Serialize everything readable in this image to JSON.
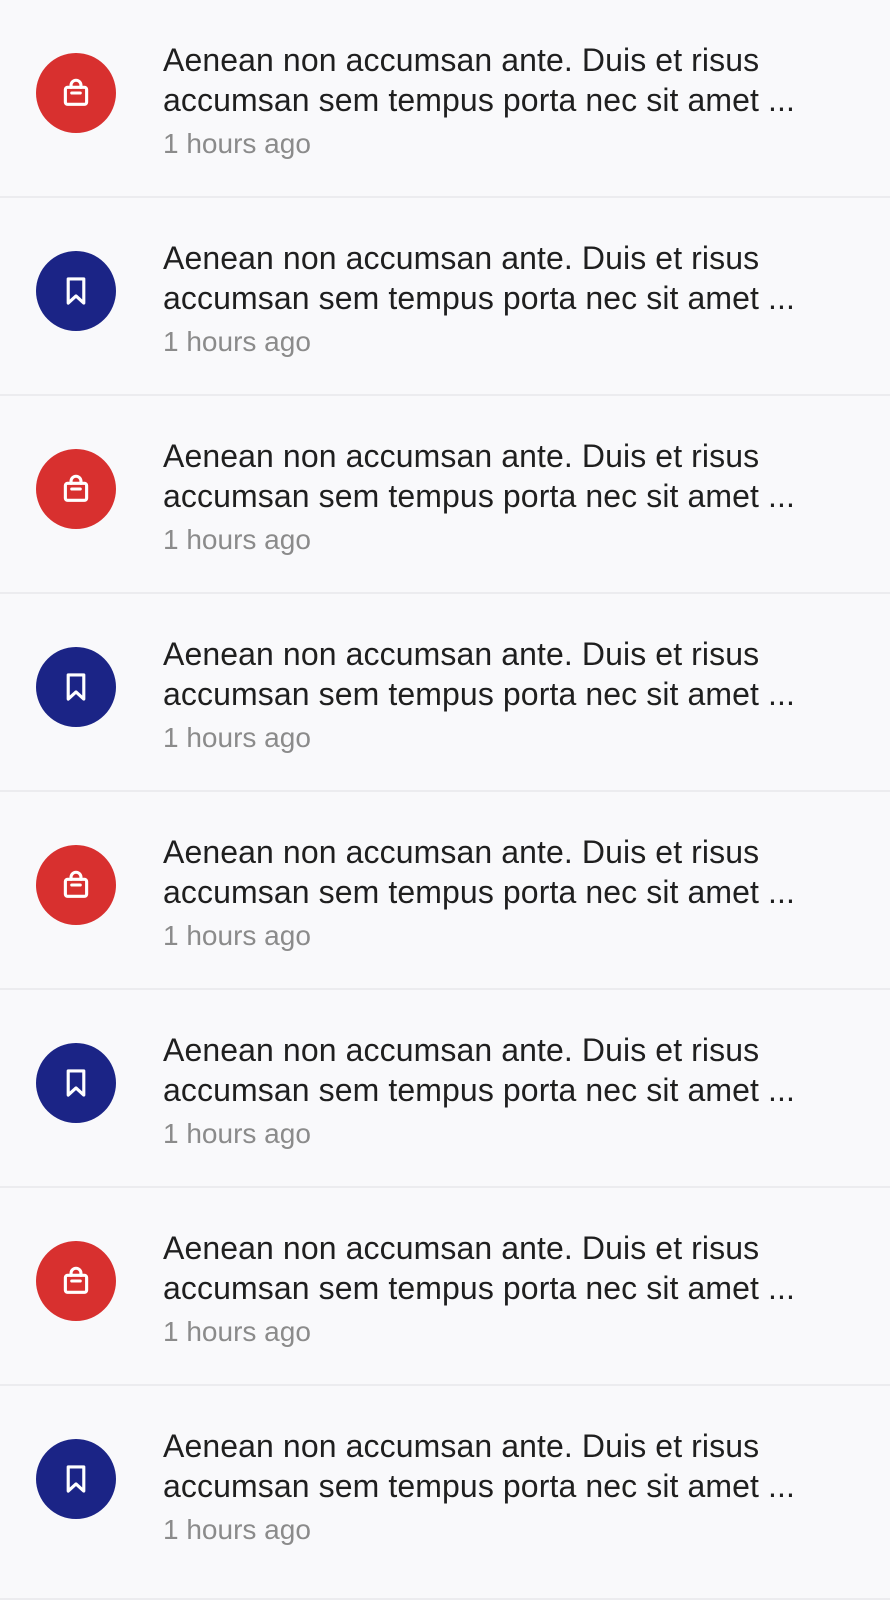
{
  "notifications": [
    {
      "icon": "shopping-bag-icon",
      "color": "#d8302f",
      "message": "Aenean non accumsan ante. Duis et risus accumsan sem tempus porta nec sit amet ...",
      "time": "1 hours ago"
    },
    {
      "icon": "bookmark-icon",
      "color": "#1b2486",
      "message": "Aenean non accumsan ante. Duis et risus accumsan sem tempus porta nec sit amet ...",
      "time": "1 hours ago"
    },
    {
      "icon": "shopping-bag-icon",
      "color": "#d8302f",
      "message": "Aenean non accumsan ante. Duis et risus accumsan sem tempus porta nec sit amet ...",
      "time": "1 hours ago"
    },
    {
      "icon": "bookmark-icon",
      "color": "#1b2486",
      "message": "Aenean non accumsan ante. Duis et risus accumsan sem tempus porta nec sit amet ...",
      "time": "1 hours ago"
    },
    {
      "icon": "shopping-bag-icon",
      "color": "#d8302f",
      "message": "Aenean non accumsan ante. Duis et risus accumsan sem tempus porta nec sit amet ...",
      "time": "1 hours ago"
    },
    {
      "icon": "bookmark-icon",
      "color": "#1b2486",
      "message": "Aenean non accumsan ante. Duis et risus accumsan sem tempus porta nec sit amet ...",
      "time": "1 hours ago"
    },
    {
      "icon": "shopping-bag-icon",
      "color": "#d8302f",
      "message": "Aenean non accumsan ante. Duis et risus accumsan sem tempus porta nec sit amet ...",
      "time": "1 hours ago"
    },
    {
      "icon": "bookmark-icon",
      "color": "#1b2486",
      "message": "Aenean non accumsan ante. Duis et risus accumsan sem tempus porta nec sit amet ...",
      "time": "1 hours ago"
    }
  ]
}
